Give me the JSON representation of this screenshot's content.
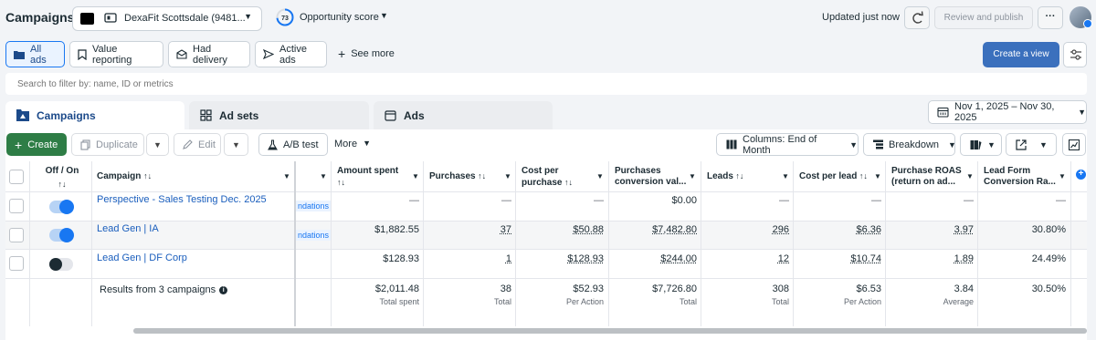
{
  "header": {
    "title": "Campaigns",
    "account": "DexaFit Scottsdale (9481...",
    "opportunity_score": "73",
    "opportunity_label": "Opportunity score",
    "updated": "Updated just now",
    "review_publish": "Review and publish"
  },
  "filters": {
    "pills": [
      "All ads",
      "Value reporting",
      "Had delivery",
      "Active ads"
    ],
    "see_more": "See more",
    "create_view": "Create a view",
    "search_placeholder": "Search to filter by: name, ID or metrics"
  },
  "tabs": {
    "campaigns": "Campaigns",
    "adsets": "Ad sets",
    "ads": "Ads",
    "date_range": "Nov 1, 2025 – Nov 30, 2025"
  },
  "toolbar": {
    "create": "Create",
    "duplicate": "Duplicate",
    "edit": "Edit",
    "ab_test": "A/B test",
    "more": "More",
    "columns": "Columns: End of Month",
    "breakdown": "Breakdown"
  },
  "table": {
    "headers": {
      "off_on": "Off / On",
      "campaign": "Campaign",
      "amount_spent": "Amount spent",
      "purchases": "Purchases",
      "cost_per_purchase_1": "Cost per",
      "cost_per_purchase_2": "purchase",
      "purchases_conv_1": "Purchases",
      "purchases_conv_2": "conversion val...",
      "leads": "Leads",
      "cost_per_lead": "Cost per lead",
      "roas_1": "Purchase ROAS",
      "roas_2": "(return on ad...",
      "lead_form_1": "Lead Form",
      "lead_form_2": "Conversion Ra..."
    },
    "rows": [
      {
        "name": "Perspective - Sales Testing Dec. 2025",
        "status": "on",
        "rec": "ndations",
        "amount_spent": "—",
        "purchases": "—",
        "cost_per_purchase": "—",
        "purchases_value": "$0.00",
        "leads": "—",
        "cost_per_lead": "—",
        "roas": "—",
        "lead_form_rate": "—"
      },
      {
        "name": "Lead Gen | IA",
        "status": "on",
        "rec": "ndations",
        "amount_spent": "$1,882.55",
        "purchases": "37",
        "cost_per_purchase": "$50.88",
        "purchases_value": "$7,482.80",
        "leads": "296",
        "cost_per_lead": "$6.36",
        "roas": "3.97",
        "lead_form_rate": "30.80%"
      },
      {
        "name": "Lead Gen | DF Corp",
        "status": "off",
        "rec": "",
        "amount_spent": "$128.93",
        "purchases": "1",
        "cost_per_purchase": "$128.93",
        "purchases_value": "$244.00",
        "leads": "12",
        "cost_per_lead": "$10.74",
        "roas": "1.89",
        "lead_form_rate": "24.49%"
      }
    ],
    "totals": {
      "label": "Results from 3 campaigns",
      "amount_spent": "$2,011.48",
      "amount_spent_sub": "Total spent",
      "purchases": "38",
      "purchases_sub": "Total",
      "cost_per_purchase": "$52.93",
      "cost_per_purchase_sub": "Per Action",
      "purchases_value": "$7,726.80",
      "purchases_value_sub": "Total",
      "leads": "308",
      "leads_sub": "Total",
      "cost_per_lead": "$6.53",
      "cost_per_lead_sub": "Per Action",
      "roas": "3.84",
      "roas_sub": "Average",
      "lead_form_rate": "30.50%"
    }
  },
  "colors": {
    "primary_blue": "#1877f2",
    "create_green": "#2e7d46",
    "create_view_blue": "#3b70bd"
  }
}
